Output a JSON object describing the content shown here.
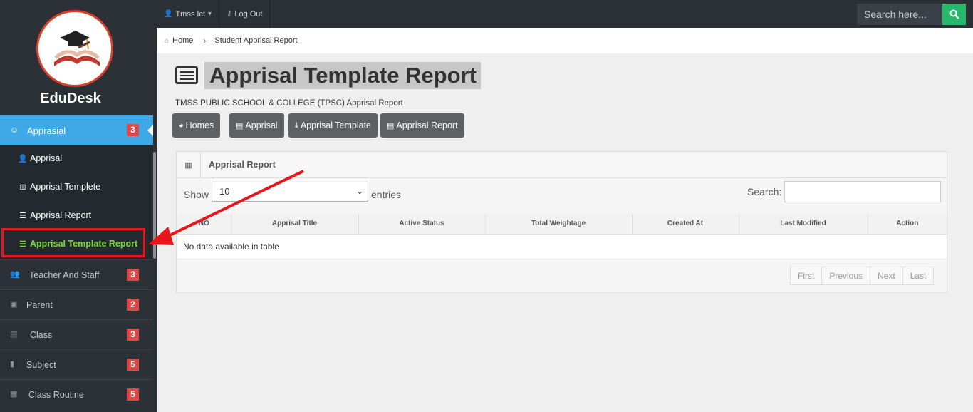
{
  "sidebar": {
    "brand": "EduDesk",
    "active_menu": {
      "icon": "smile-icon",
      "label": "Apprasial",
      "badge": "3"
    },
    "submenu": [
      {
        "icon": "user-icon",
        "label": "Apprisal"
      },
      {
        "icon": "network-icon",
        "label": "Apprisal Templete"
      },
      {
        "icon": "list-icon",
        "label": "Apprisal Report"
      },
      {
        "icon": "list-icon",
        "label": "Apprisal Template Report"
      }
    ],
    "menu": [
      {
        "icon": "users-icon",
        "label": "Teacher And Staff",
        "badge": "3"
      },
      {
        "icon": "contact-icon",
        "label": "Parent",
        "badge": "2"
      },
      {
        "icon": "id-card-icon",
        "label": "Class",
        "badge": "3"
      },
      {
        "icon": "bookmark-icon",
        "label": "Subject",
        "badge": "5"
      },
      {
        "icon": "calendar-icon",
        "label": "Class Routine",
        "badge": "5"
      }
    ]
  },
  "topbar": {
    "user": "Tmss Ict",
    "logout": "Log Out",
    "search_placeholder": "Search here..."
  },
  "breadcrumb": {
    "home": "Home",
    "current": "Student Apprisal Report"
  },
  "page": {
    "title": "Apprisal Template Report",
    "school": "TMSS PUBLIC SCHOOL & COLLEGE (TPSC) Apprisal Report",
    "buttons": [
      {
        "icon": "dashboard-icon",
        "label": "Homes"
      },
      {
        "icon": "id-card-icon",
        "label": "Apprisal"
      },
      {
        "icon": "download-icon",
        "label": "Apprisal Template"
      },
      {
        "icon": "list-box-icon",
        "label": "Apprisal Report"
      }
    ]
  },
  "panel": {
    "title": "Apprisal Report",
    "show_label": "Show",
    "page_size": "10",
    "entries_label": "entries",
    "search_label": "Search:",
    "columns": [
      "NO",
      "Apprisal Title",
      "Active Status",
      "Total Weightage",
      "Created At",
      "Last Modified",
      "Action"
    ],
    "empty_text": "No data available in table",
    "pager": [
      "First",
      "Previous",
      "Next",
      "Last"
    ]
  }
}
